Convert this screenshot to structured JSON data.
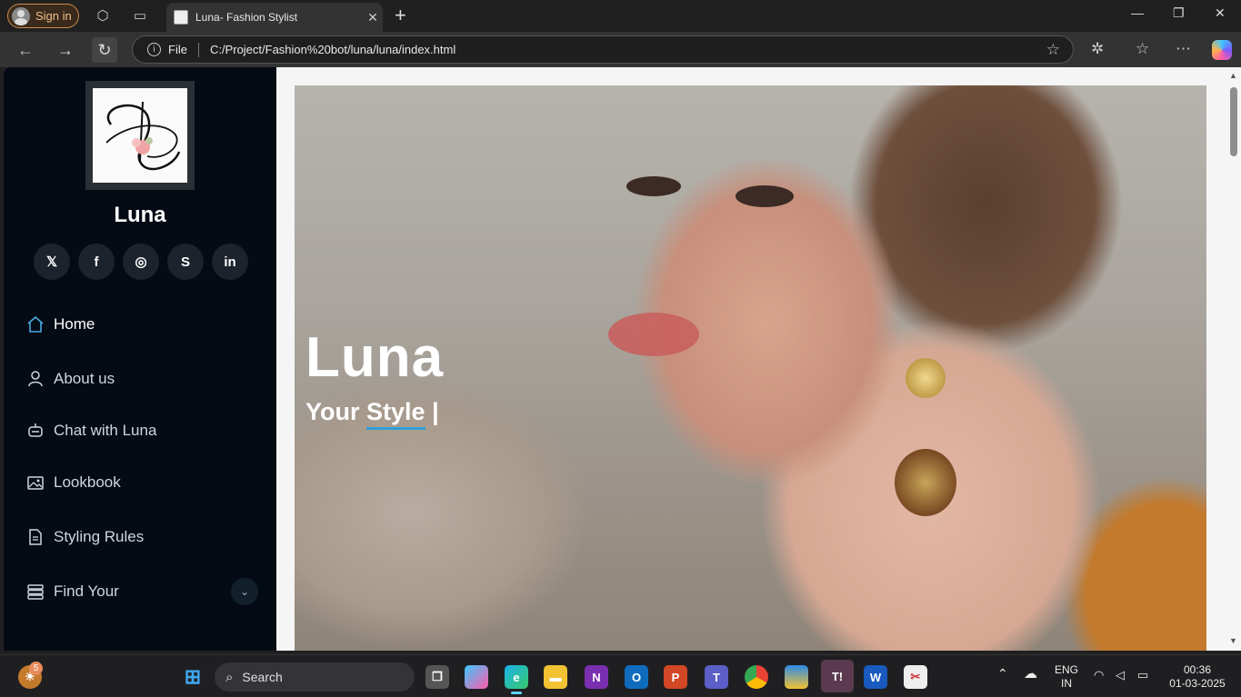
{
  "browser": {
    "signin_label": "Sign in",
    "tab_title": "Luna- Fashion Stylist",
    "url_scheme_label": "File",
    "url": "C:/Project/Fashion%20bot/luna/luna/index.html"
  },
  "sidebar": {
    "brand": "Luna",
    "socials": [
      "x-icon",
      "facebook-icon",
      "instagram-icon",
      "skype-icon",
      "linkedin-icon"
    ],
    "nav": [
      {
        "label": "Home",
        "icon": "home-icon",
        "active": true
      },
      {
        "label": "About us",
        "icon": "user-icon"
      },
      {
        "label": "Chat with Luna",
        "icon": "robot-icon"
      },
      {
        "label": "Lookbook",
        "icon": "images-icon"
      },
      {
        "label": "Styling Rules",
        "icon": "document-icon"
      },
      {
        "label": "Find Your",
        "icon": "stack-icon"
      }
    ]
  },
  "hero": {
    "title": "Luna",
    "subtitle_prefix": "Your",
    "subtitle_typed": "Style",
    "cursor": "|"
  },
  "taskbar": {
    "widgets_badge": "5",
    "search_label": "Search",
    "language": "ENG",
    "region": "IN",
    "time": "00:36",
    "date": "01-03-2025"
  },
  "colors": {
    "sidebar_bg": "#040b14",
    "accent": "#2fa0d8",
    "active_icon": "#4aa8e0"
  }
}
